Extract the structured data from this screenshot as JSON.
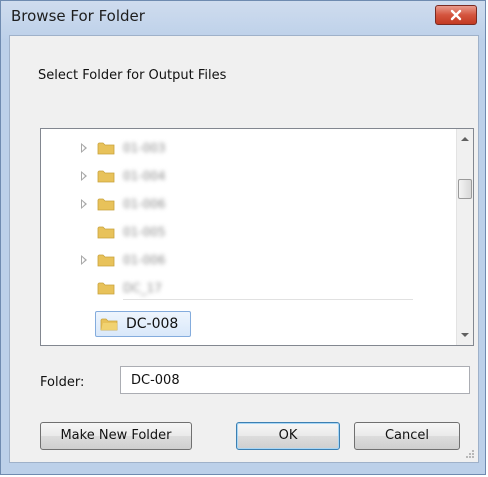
{
  "window": {
    "title": "Browse For Folder"
  },
  "dialog": {
    "instruction": "Select Folder for Output Files"
  },
  "tree": {
    "rows": [
      {
        "label": "01-003",
        "has_expander": true
      },
      {
        "label": "01-004",
        "has_expander": true
      },
      {
        "label": "01-006",
        "has_expander": true
      },
      {
        "label": "01-005",
        "has_expander": false
      },
      {
        "label": "01-006",
        "has_expander": true
      },
      {
        "label": "DC_17",
        "has_expander": false
      }
    ],
    "selected_label": "DC-008"
  },
  "folder_field": {
    "label": "Folder:",
    "value": "DC-008"
  },
  "buttons": {
    "make_new_folder": "Make New Folder",
    "ok": "OK",
    "cancel": "Cancel"
  },
  "icons": {
    "close": "close-icon",
    "folder": "folder-icon",
    "expander": "chevron-right-icon",
    "scroll_up": "scroll-up-arrow-icon",
    "scroll_down": "scroll-down-arrow-icon",
    "resize_grip": "resize-grip-icon"
  },
  "colors": {
    "title_bg": "#bcd0e9",
    "client_bg": "#f0f0f0",
    "close_button": "#c23a22",
    "selection_border": "#84acdd",
    "folder_yellow": "#e8c25a"
  }
}
